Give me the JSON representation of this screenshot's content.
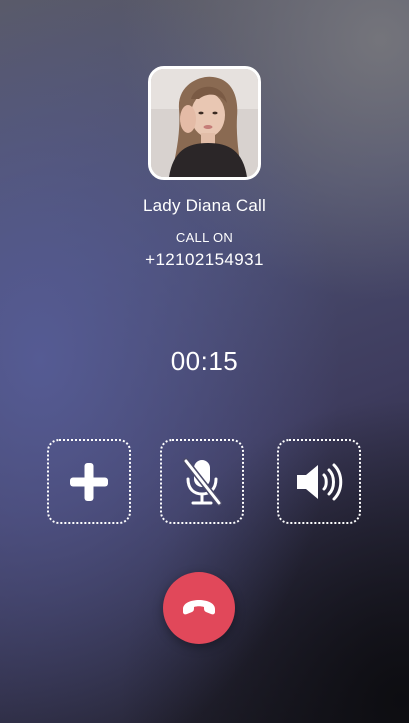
{
  "caller": {
    "name": "Lady Diana Call",
    "status": "CALL ON",
    "number": "+12102154931"
  },
  "call": {
    "timer": "00:15"
  },
  "controls": [
    {
      "id": "add",
      "icon": "plus-icon"
    },
    {
      "id": "mute",
      "icon": "microphone-muted-icon"
    },
    {
      "id": "speaker",
      "icon": "speaker-icon"
    }
  ],
  "end_call": {
    "icon": "phone-hangup-icon",
    "color": "#e1485a"
  },
  "colors": {
    "text": "#ffffff",
    "end_call": "#e1485a"
  }
}
